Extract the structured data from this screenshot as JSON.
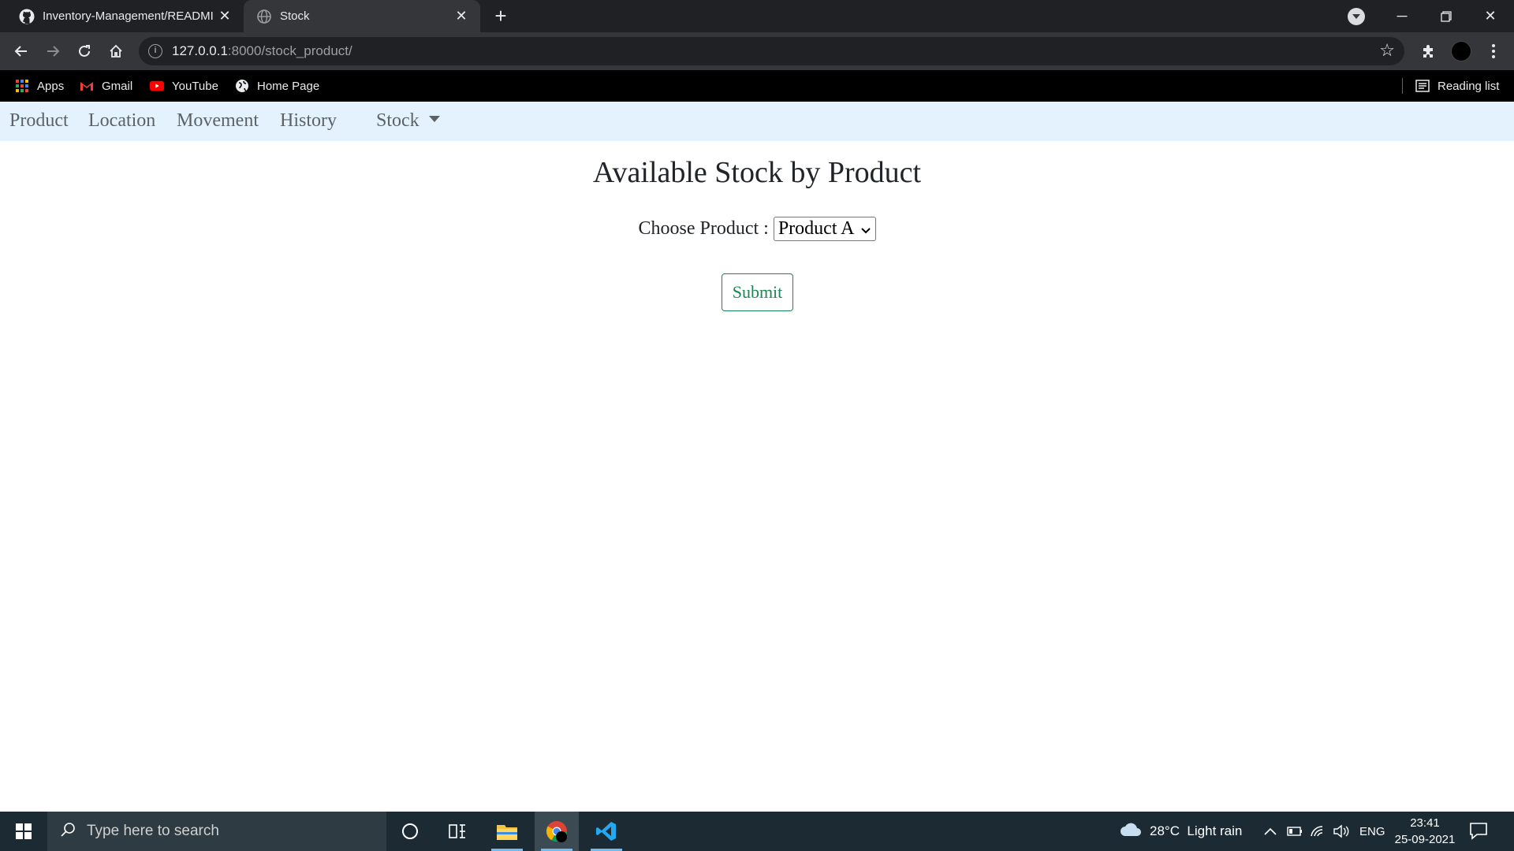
{
  "browser": {
    "tabs": [
      {
        "title": "Inventory-Management/READMI",
        "active": false
      },
      {
        "title": "Stock",
        "active": true
      }
    ],
    "address": {
      "host": "127.0.0.1",
      "rest": ":8000/stock_product/"
    },
    "bookmarks": [
      {
        "label": "Apps"
      },
      {
        "label": "Gmail"
      },
      {
        "label": "YouTube"
      },
      {
        "label": "Home Page"
      }
    ],
    "reading_list": "Reading list"
  },
  "navbar": {
    "items": [
      "Product",
      "Location",
      "Movement",
      "History"
    ],
    "dropdown": "Stock"
  },
  "main": {
    "heading": "Available Stock by Product",
    "choose_label": "Choose Product :",
    "selected_product": "Product A",
    "submit_label": "Submit"
  },
  "taskbar": {
    "search_placeholder": "Type here to search",
    "weather": "28°C  Light rain",
    "language": "ENG",
    "time": "23:41",
    "date": "25-09-2021"
  },
  "colors": {
    "navbar_bg": "#e3f2fd",
    "submit_accent": "#198754",
    "chrome_dark": "#202124",
    "taskbar_bg": "#1c2b33"
  },
  "icons": [
    "github-icon",
    "globe-icon",
    "close-icon",
    "plus-icon",
    "back-icon",
    "forward-icon",
    "reload-icon",
    "home-icon",
    "info-icon",
    "star-icon",
    "puzzle-icon",
    "kebab-menu-icon",
    "apps-grid-icon",
    "gmail-icon",
    "youtube-icon",
    "windows-start-icon",
    "search-icon",
    "cortana-icon",
    "task-view-icon",
    "file-explorer-icon",
    "chrome-icon",
    "vscode-icon",
    "cloud-icon",
    "notification-icon"
  ]
}
